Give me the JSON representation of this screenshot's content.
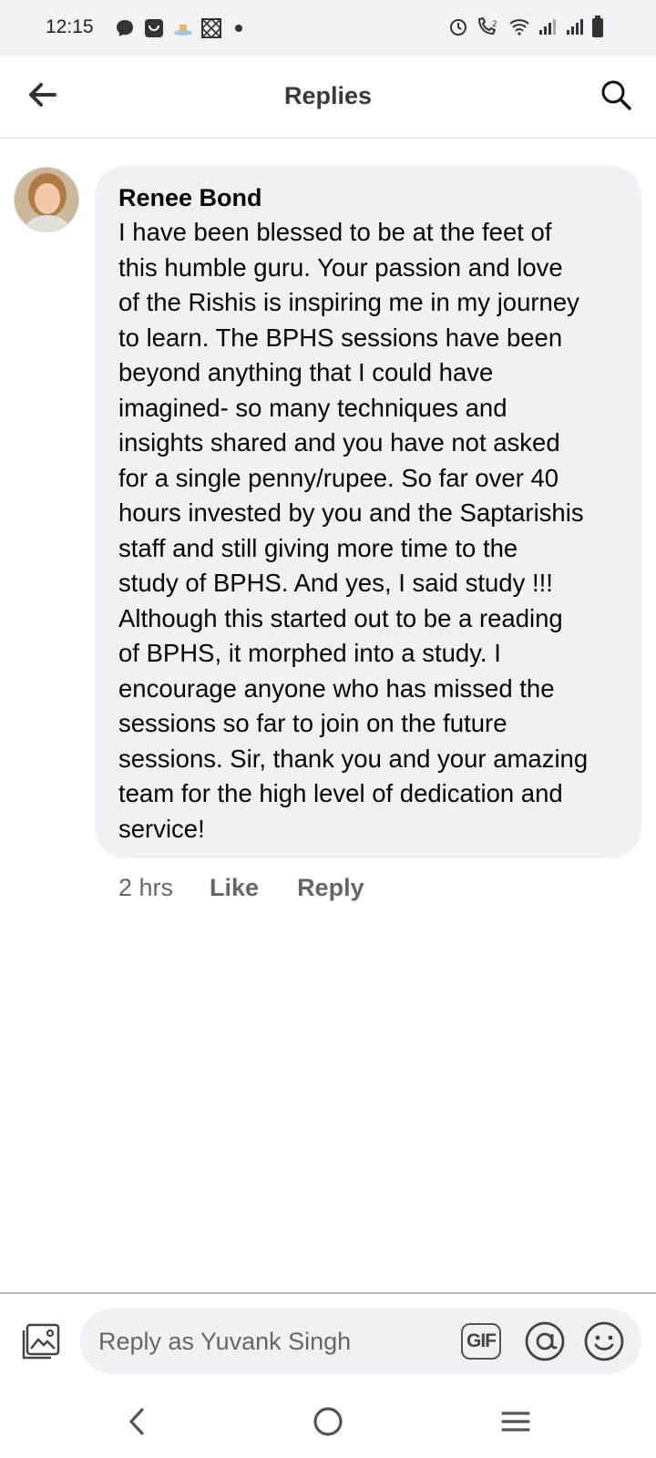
{
  "status_bar": {
    "time": "12:15",
    "icons_left": [
      "messenger-icon",
      "shopping-bag-icon",
      "app-notification-icon",
      "grid-pattern-icon",
      "dot-icon"
    ],
    "icons_right": [
      "alarm-icon",
      "wifi-calling-icon",
      "wifi-icon",
      "signal-icon",
      "signal-icon",
      "battery-icon"
    ]
  },
  "header": {
    "title": "Replies",
    "back_icon": "arrow-left-icon",
    "search_icon": "search-icon"
  },
  "comment": {
    "author": "Renee Bond",
    "text": "I have been blessed to be at the feet of\nthis humble guru.  Your passion and love\nof the Rishis is inspiring me in my journey\nto learn.  The BPHS sessions have been\nbeyond anything that I could have\nimagined- so many techniques and\ninsights shared and you have not asked\nfor a single penny/rupee.  So far over 40\nhours invested by you and the Saptarishis\nstaff and still giving more time to the\nstudy of BPHS.  And yes, I said study !!!\nAlthough this started out to be a reading\nof BPHS, it morphed into a study.  I\nencourage anyone who has missed the\nsessions so far to join on the future\nsessions. Sir, thank you and your amazing\nteam for the high level of dedication and\nservice!",
    "time": "2 hrs",
    "like_label": "Like",
    "reply_label": "Reply"
  },
  "composer": {
    "placeholder": "Reply as Yuvank Singh",
    "value": "",
    "gif_label": "GIF",
    "icons": [
      "photo-icon",
      "at-sign-icon",
      "emoji-icon"
    ]
  },
  "nav_bar": {
    "icons": [
      "back-chevron-icon",
      "home-circle-icon",
      "recents-menu-icon"
    ]
  },
  "colors": {
    "bubble_bg": "#f0f1f5",
    "secondary_text": "#65676b",
    "status_bar_bg": "#f3f3f7"
  }
}
